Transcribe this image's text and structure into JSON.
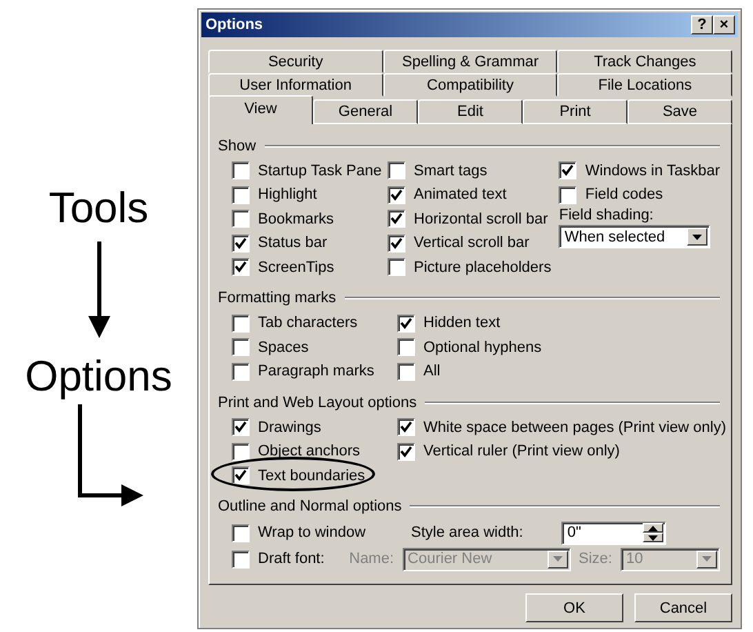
{
  "annotation": [
    {
      "text": "Tools"
    },
    {
      "text": "Options"
    }
  ],
  "window": {
    "title": "Options",
    "controls": [
      "?",
      "×"
    ]
  },
  "tab_rows": [
    [
      {
        "label": "Security",
        "selected": false
      },
      {
        "label": "Spelling & Grammar",
        "selected": false
      },
      {
        "label": "Track Changes",
        "selected": false
      }
    ],
    [
      {
        "label": "User Information",
        "selected": false
      },
      {
        "label": "Compatibility",
        "selected": false
      },
      {
        "label": "File Locations",
        "selected": false
      }
    ],
    [
      {
        "label": "View",
        "selected": true
      },
      {
        "label": "General",
        "selected": false
      },
      {
        "label": "Edit",
        "selected": false
      },
      {
        "label": "Print",
        "selected": false
      },
      {
        "label": "Save",
        "selected": false
      }
    ]
  ],
  "sections": [
    {
      "title": "Show",
      "columns": [
        [
          {
            "kind": "checkbox",
            "label": "Startup Task Pane",
            "checked": false
          },
          {
            "kind": "checkbox",
            "label": "Highlight",
            "checked": false
          },
          {
            "kind": "checkbox",
            "label": "Bookmarks",
            "checked": false
          },
          {
            "kind": "checkbox",
            "label": "Status bar",
            "checked": true
          },
          {
            "kind": "checkbox",
            "label": "ScreenTips",
            "checked": true
          }
        ],
        [
          {
            "kind": "checkbox",
            "label": "Smart tags",
            "checked": false
          },
          {
            "kind": "checkbox",
            "label": "Animated text",
            "checked": true
          },
          {
            "kind": "checkbox",
            "label": "Horizontal scroll bar",
            "checked": true
          },
          {
            "kind": "checkbox",
            "label": "Vertical scroll bar",
            "checked": true
          },
          {
            "kind": "checkbox",
            "label": "Picture placeholders",
            "checked": false
          }
        ],
        [
          {
            "kind": "checkbox",
            "label": "Windows in Taskbar",
            "checked": true
          },
          {
            "kind": "checkbox",
            "label": "Field codes",
            "checked": false
          },
          {
            "kind": "dropdown",
            "label": "Field shading:",
            "value": "When selected"
          }
        ]
      ]
    },
    {
      "title": "Formatting marks",
      "columns": [
        [
          {
            "kind": "checkbox",
            "label": "Tab characters",
            "checked": false
          },
          {
            "kind": "checkbox",
            "label": "Spaces",
            "checked": false
          },
          {
            "kind": "checkbox",
            "label": "Paragraph marks",
            "checked": false
          }
        ],
        [
          {
            "kind": "checkbox",
            "label": "Hidden text",
            "checked": true
          },
          {
            "kind": "checkbox",
            "label": "Optional hyphens",
            "checked": false
          },
          {
            "kind": "checkbox",
            "label": "All",
            "checked": false
          }
        ]
      ]
    },
    {
      "title": "Print and Web Layout options",
      "columns": [
        [
          {
            "kind": "checkbox",
            "label": "Drawings",
            "checked": true
          },
          {
            "kind": "checkbox",
            "label": "Object anchors",
            "checked": false
          },
          {
            "kind": "checkbox",
            "label": "Text boundaries",
            "checked": true,
            "circled": true
          }
        ],
        [
          {
            "kind": "checkbox",
            "label": "White space between pages (Print view only)",
            "checked": true
          },
          {
            "kind": "checkbox",
            "label": "Vertical ruler (Print view only)",
            "checked": true
          }
        ]
      ]
    },
    {
      "title": "Outline and Normal options",
      "lines": [
        {
          "option": {
            "kind": "checkbox",
            "label": "Wrap to window",
            "checked": false
          },
          "fields": [
            {
              "kind": "label",
              "label": "Style area width:",
              "disabled": false
            },
            {
              "kind": "spin",
              "value": "0\""
            }
          ]
        },
        {
          "option": {
            "kind": "checkbox",
            "label": "Draft font:",
            "checked": false
          },
          "fields": [
            {
              "kind": "label",
              "label": "Name:",
              "disabled": true
            },
            {
              "kind": "dropdown",
              "value": "Courier New",
              "disabled": true
            },
            {
              "kind": "label",
              "label": "Size:",
              "disabled": true
            },
            {
              "kind": "dropdown",
              "value": "10",
              "disabled": true
            }
          ]
        }
      ]
    }
  ],
  "buttons": [
    "OK",
    "Cancel"
  ]
}
